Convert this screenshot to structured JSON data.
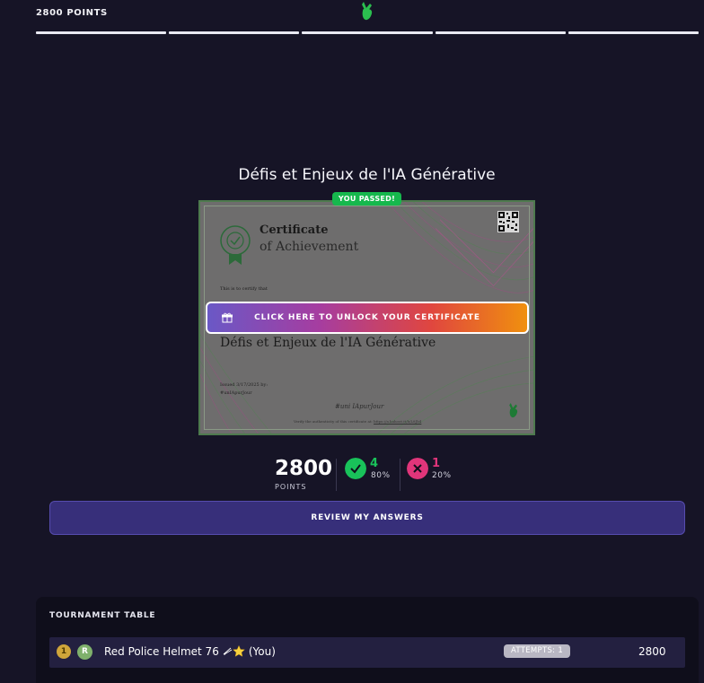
{
  "header": {
    "points_label": "2800 POINTS",
    "logo_icon": "hand-logo-icon",
    "progress_segments": 5
  },
  "quiz": {
    "title": "Défis et Enjeux de l'IA Générative",
    "passed_badge": "YOU PASSED!"
  },
  "certificate": {
    "heading": "Certificate",
    "subheading": "of Achievement",
    "certify_text": "This is to certify that",
    "course_name": "Défis et Enjeux de l'IA Générative",
    "issued_line1": "Issued 3/17/2025 by:",
    "issued_line2": "#unIApurJour",
    "signature": "#uni IApurJour",
    "verify_text": "Verify the authenticity of this certificate at:",
    "verify_link": "https://a.kahoot.it/b/L8Jb4",
    "unlock_button": "CLICK HERE TO UNLOCK YOUR CERTIFICATE"
  },
  "stats": {
    "points_value": "2800",
    "points_label": "POINTS",
    "correct_count": "4",
    "correct_pct": "80%",
    "incorrect_count": "1",
    "incorrect_pct": "20%"
  },
  "review_button": "REVIEW MY ANSWERS",
  "tournament": {
    "title": "TOURNAMENT TABLE",
    "rows": [
      {
        "rank": "1",
        "avatar_letter": "R",
        "name": "Red Police Helmet 76",
        "you_label": "(You)",
        "attempts": "ATTEMPTS: 1",
        "score": "2800"
      }
    ]
  },
  "colors": {
    "background": "#161426",
    "passed": "#16b84d",
    "correct": "#19c25a",
    "incorrect": "#e0357a",
    "review_button": "#372f7a",
    "medal": "#cfa53a"
  }
}
